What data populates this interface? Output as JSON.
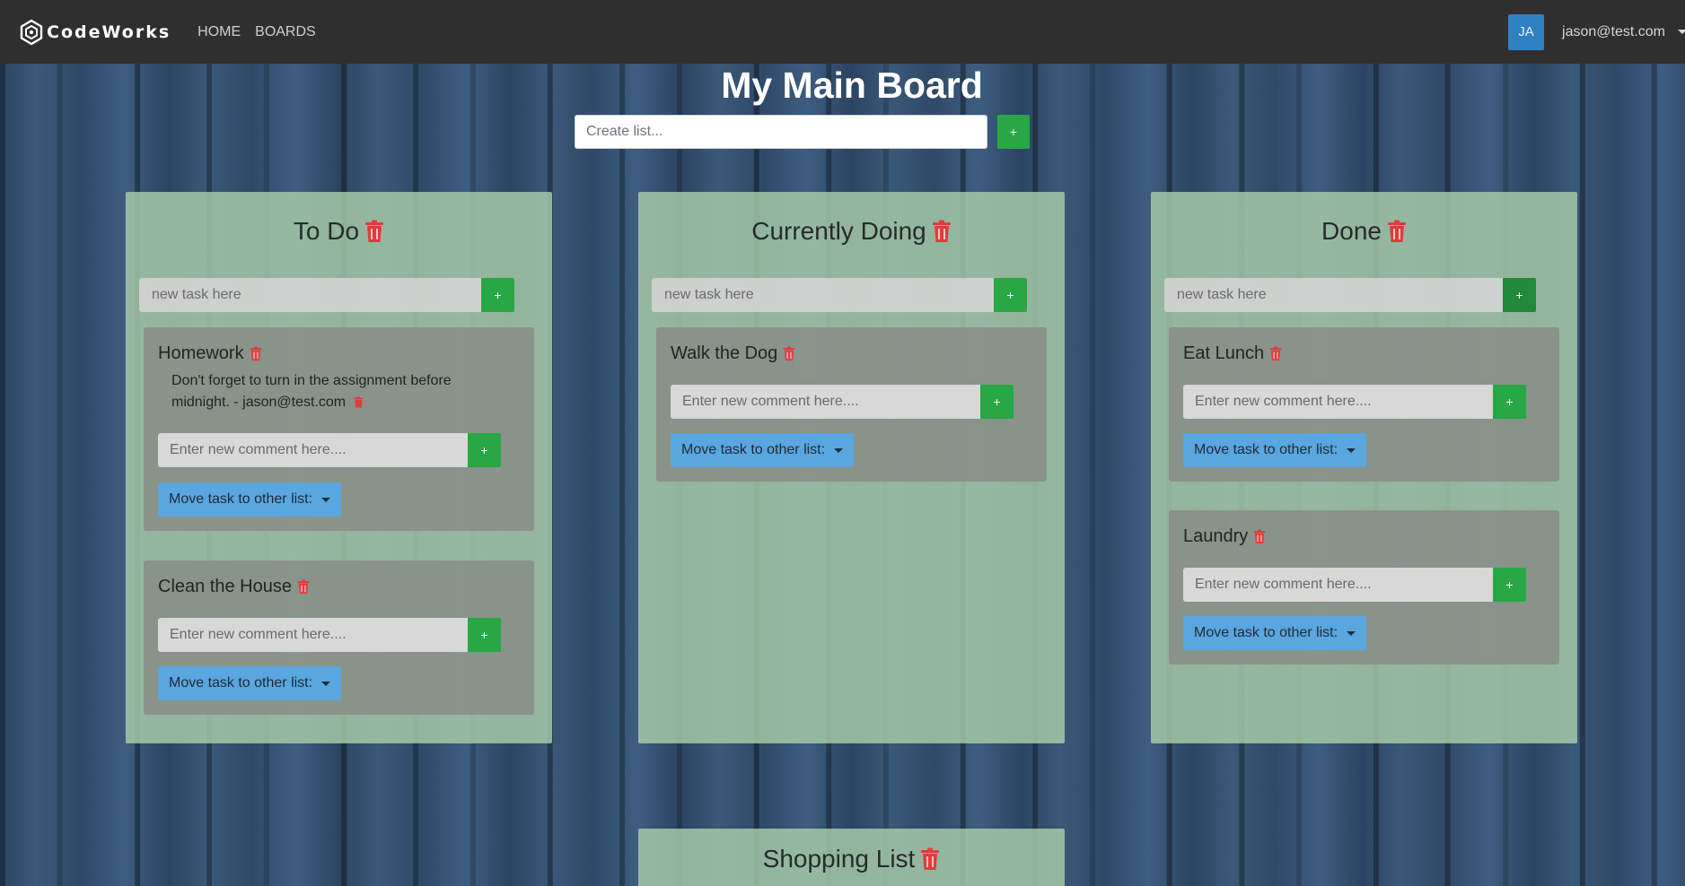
{
  "nav": {
    "brand": "CodeWorks",
    "links": [
      "HOME",
      "BOARDS"
    ],
    "user": {
      "initials": "JA",
      "email": "jason@test.com"
    }
  },
  "board": {
    "title": "My Main Board",
    "create_placeholder": "Create list...",
    "add_label": "+"
  },
  "colors": {
    "accent_green": "#28a745",
    "trash_red": "#e23b3b",
    "move_blue": "#5aa6de",
    "avatar_blue": "#2f80c3"
  },
  "lists": [
    {
      "title": "To Do",
      "new_task_placeholder": "new task here",
      "tasks": [
        {
          "title": "Homework",
          "comments": [
            {
              "text": "Don't forget to turn in the assignment before midnight. - jason@test.com"
            }
          ],
          "comment_placeholder": "Enter new comment here....",
          "move_label": "Move task to other list:"
        },
        {
          "title": "Clean the House",
          "comments": [],
          "comment_placeholder": "Enter new comment here....",
          "move_label": "Move task to other list:"
        }
      ]
    },
    {
      "title": "Currently Doing",
      "new_task_placeholder": "new task here",
      "tasks": [
        {
          "title": "Walk the Dog",
          "comments": [],
          "comment_placeholder": "Enter new comment here....",
          "move_label": "Move task to other list:"
        }
      ]
    },
    {
      "title": "Done",
      "new_task_placeholder": "new task here",
      "tasks": [
        {
          "title": "Eat Lunch",
          "comments": [],
          "comment_placeholder": "Enter new comment here....",
          "move_label": "Move task to other list:"
        },
        {
          "title": "Laundry",
          "comments": [],
          "comment_placeholder": "Enter new comment here....",
          "move_label": "Move task to other list:"
        }
      ]
    },
    {
      "title": "Shopping List",
      "new_task_placeholder": "",
      "tasks": []
    }
  ]
}
